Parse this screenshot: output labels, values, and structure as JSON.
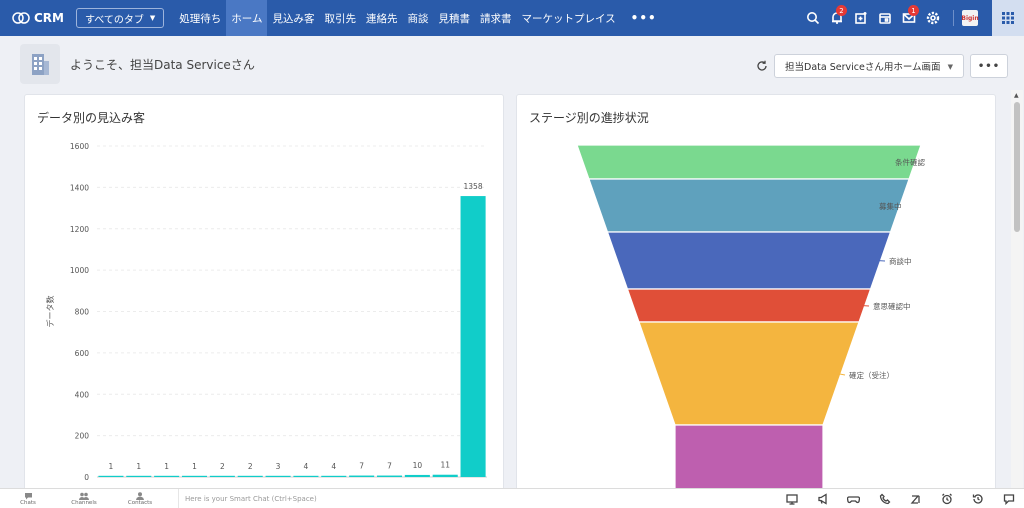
{
  "nav": {
    "logo": "CRM",
    "tab_dropdown": "すべてのタブ",
    "tabs": [
      "処理待ち",
      "ホーム",
      "見込み客",
      "取引先",
      "連絡先",
      "商談",
      "見積書",
      "請求書",
      "マーケットプレイス"
    ],
    "active_tab": "ホーム",
    "notification_count": "2",
    "mail_count": "1",
    "avatar_label": "Bigin"
  },
  "welcome": {
    "text": "ようこそ、担当Data Serviceさん",
    "home_select": "担当Data Serviceさん用ホーム画面"
  },
  "bar_card": {
    "title": "データ別の見込み客",
    "ylabel": "データ数"
  },
  "funnel_card": {
    "title": "ステージ別の進捗状況"
  },
  "chart_data": [
    {
      "type": "bar",
      "title": "データ別の見込み客",
      "ylabel": "データ数",
      "ylim": [
        0,
        1600
      ],
      "yticks": [
        0,
        200,
        400,
        600,
        800,
        1000,
        1200,
        1400,
        1600
      ],
      "grid": true,
      "color": "#11cdc9",
      "values": [
        1,
        1,
        1,
        1,
        2,
        2,
        3,
        4,
        4,
        7,
        7,
        10,
        11,
        1358
      ]
    },
    {
      "type": "funnel",
      "title": "ステージ別の進捗状況",
      "stages": [
        {
          "name": "条件確認",
          "color": "#7ad98f"
        },
        {
          "name": "募集中",
          "color": "#5fa1bd"
        },
        {
          "name": "商談中",
          "color": "#4a68bb"
        },
        {
          "name": "意思確認中",
          "color": "#e04f38"
        },
        {
          "name": "確定（受注）",
          "color": "#f4b53f"
        },
        {
          "name": "",
          "color": "#be5faf"
        }
      ]
    }
  ],
  "bottombar": {
    "items": [
      "Chats",
      "Channels",
      "Contacts"
    ],
    "smartchat": "Here is your Smart Chat (Ctrl+Space)"
  }
}
